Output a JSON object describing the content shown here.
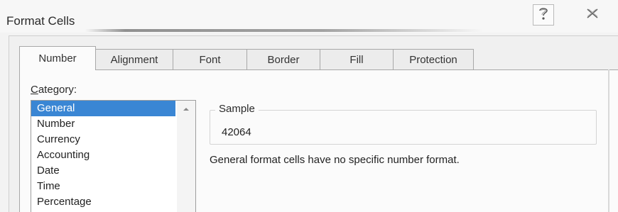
{
  "window": {
    "title": "Format Cells",
    "help_icon": "question-mark-icon",
    "close_icon": "close-x-icon"
  },
  "tabs": [
    {
      "label": "Number",
      "active": true
    },
    {
      "label": "Alignment",
      "active": false
    },
    {
      "label": "Font",
      "active": false
    },
    {
      "label": "Border",
      "active": false
    },
    {
      "label": "Fill",
      "active": false
    },
    {
      "label": "Protection",
      "active": false
    }
  ],
  "category": {
    "label_underlined": "C",
    "label_rest": "ategory:",
    "items": [
      "General",
      "Number",
      "Currency",
      "Accounting",
      "Date",
      "Time",
      "Percentage"
    ],
    "selected": "General"
  },
  "sample": {
    "legend": "Sample",
    "value": "42064"
  },
  "description": "General format cells have no specific number format.",
  "colors": {
    "selection": "#3a86d4",
    "panel": "#fbfbfb"
  }
}
